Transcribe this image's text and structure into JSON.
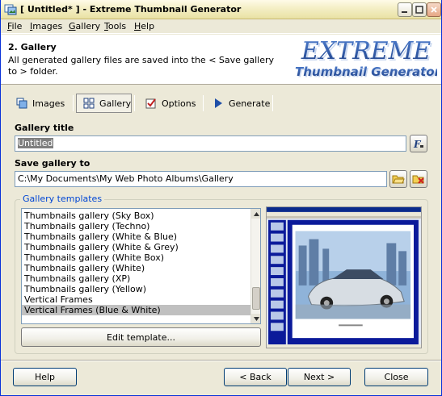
{
  "window": {
    "title": "[ Untitled* ] - Extreme Thumbnail Generator"
  },
  "menu": [
    {
      "accel": "F",
      "rest": "ile"
    },
    {
      "accel": "I",
      "rest": "mages"
    },
    {
      "accel": "G",
      "rest": "allery"
    },
    {
      "accel": "T",
      "rest": "ools"
    },
    {
      "accel": "H",
      "rest": "elp"
    }
  ],
  "header": {
    "step_title": "2. Gallery",
    "description": "All generated gallery files are saved into the < Save gallery to > folder.",
    "logo_line1": "EXTREME",
    "logo_line2": "Thumbnail Generator"
  },
  "tabs": [
    {
      "label": "Images",
      "icon": "images-icon"
    },
    {
      "label": "Gallery",
      "icon": "gallery-grid-icon"
    },
    {
      "label": "Options",
      "icon": "checkbox-options-icon"
    },
    {
      "label": "Generate",
      "icon": "play-arrow-icon"
    }
  ],
  "gallery_title": {
    "label": "Gallery title",
    "value": "Untitled"
  },
  "save_to": {
    "label": "Save gallery to",
    "value": "C:\\My Documents\\My Web Photo Albums\\Gallery"
  },
  "templates": {
    "legend": "Gallery templates",
    "items": [
      "Thumbnails gallery (Sky Box)",
      "Thumbnails gallery (Techno)",
      "Thumbnails gallery (White & Blue)",
      "Thumbnails gallery (White & Grey)",
      "Thumbnails gallery (White Box)",
      "Thumbnails gallery (White)",
      "Thumbnails gallery (XP)",
      "Thumbnails gallery (Yellow)",
      "Vertical Frames",
      "Vertical Frames (Blue & White)"
    ],
    "selected_index": 9,
    "edit_button": "Edit template..."
  },
  "footer": {
    "help": "Help",
    "back": "< Back",
    "next": "Next >",
    "close": "Close"
  },
  "colors": {
    "titlebar": "#f5f0c8",
    "dialog": "#ece9d8",
    "accent": "#0046d5",
    "logo_blue": "#2a4e9a"
  }
}
